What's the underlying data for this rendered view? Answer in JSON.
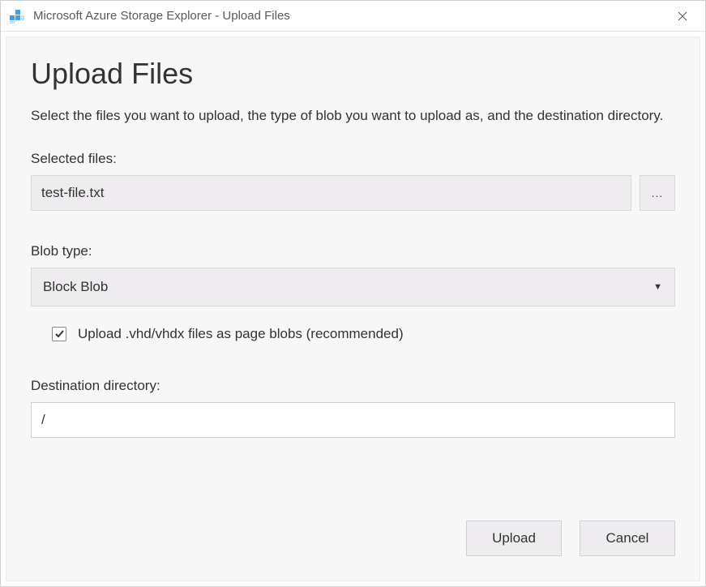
{
  "titlebar": {
    "title": "Microsoft Azure Storage Explorer - Upload Files"
  },
  "dialog": {
    "heading": "Upload Files",
    "description": "Select the files you want to upload, the type of blob you want to upload as, and the destination directory.",
    "selected_files": {
      "label": "Selected files:",
      "value": "test-file.txt",
      "browse_label": "..."
    },
    "blob_type": {
      "label": "Blob type:",
      "value": "Block Blob"
    },
    "vhd_checkbox": {
      "checked": true,
      "label": "Upload .vhd/vhdx files as page blobs (recommended)"
    },
    "destination": {
      "label": "Destination directory:",
      "value": "/"
    },
    "buttons": {
      "upload": "Upload",
      "cancel": "Cancel"
    }
  }
}
